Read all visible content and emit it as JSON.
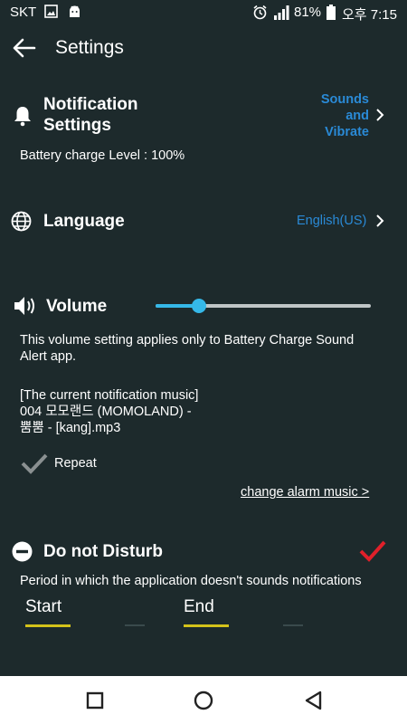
{
  "status_bar": {
    "carrier": "SKT",
    "battery_percent": "81%",
    "time": "오후 7:15"
  },
  "app_bar": {
    "title": "Settings",
    "back_icon": "arrow-left-icon"
  },
  "notification": {
    "title_line1": "Notification",
    "title_line2": "Settings",
    "link_line1": "Sounds",
    "link_line2": "and",
    "link_line3": "Vibrate",
    "battery_level_text": "Battery charge Level : 100%",
    "icon": "bell-icon"
  },
  "language": {
    "title": "Language",
    "value": "English(US)",
    "icon": "globe-icon"
  },
  "volume": {
    "title": "Volume",
    "level_percent": 20,
    "description_line1": "This volume setting applies only to Battery Charge Sound",
    "description_line2": "Alert app.",
    "current_music_label": "[The current notification music]",
    "music_line1": "004 모모랜드 (MOMOLAND) -",
    "music_line2": "뿜뿜 - [kang].mp3",
    "repeat_label": "Repeat",
    "change_link": "change alarm music >",
    "icon": "speaker-icon"
  },
  "dnd": {
    "title": "Do not Disturb",
    "description": "Period in which the application doesn't sounds notifications",
    "start_label": "Start",
    "end_label": "End",
    "enabled": true,
    "check_color": "#e0202a",
    "icon": "minus-circle-icon"
  },
  "colors": {
    "background": "#1d2a2c",
    "accent": "#2a8ad6",
    "slider": "#35b8e8"
  },
  "nav_bar": {
    "icons": [
      "recent-apps-icon",
      "home-icon",
      "back-icon"
    ]
  }
}
